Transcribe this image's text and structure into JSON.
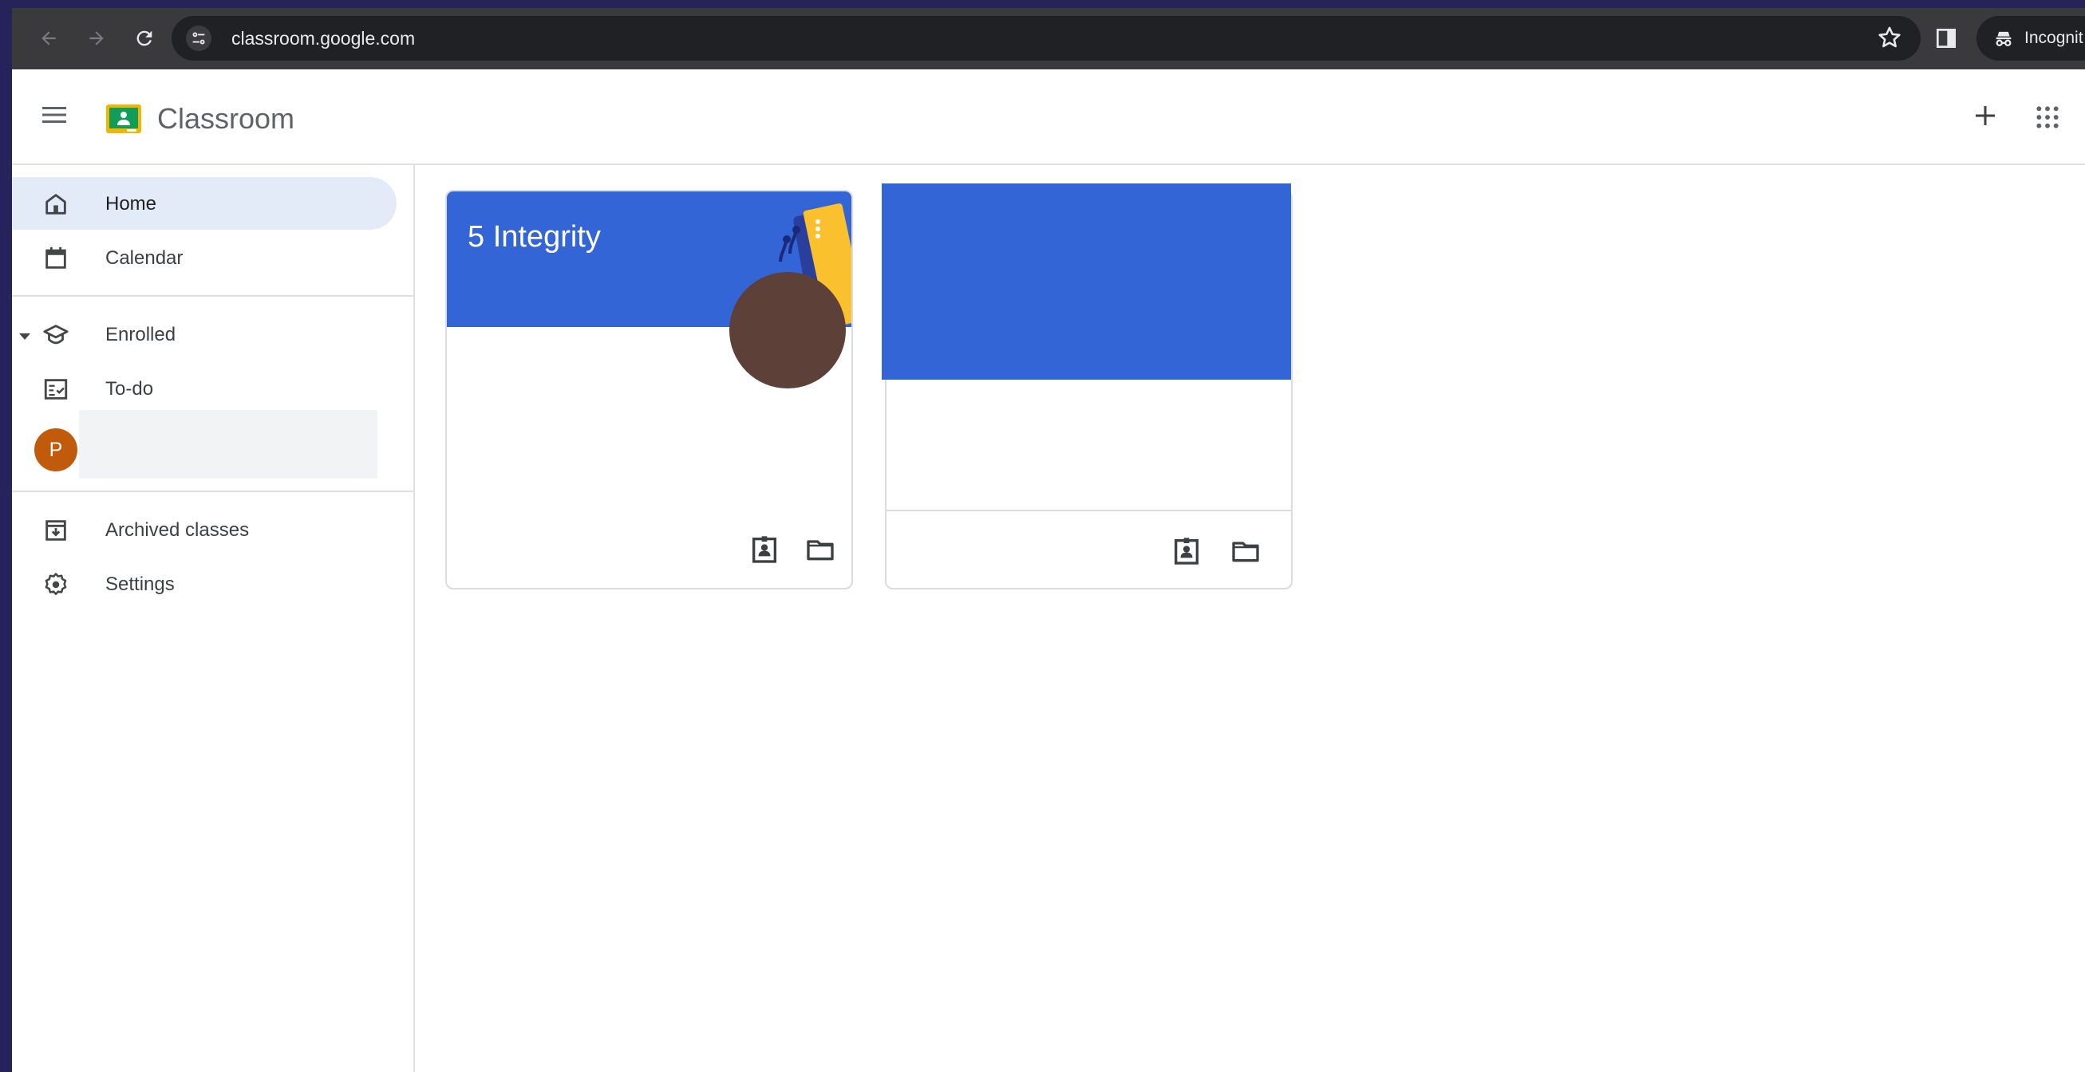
{
  "browser": {
    "url": "classroom.google.com",
    "incognito_label": "Incognit"
  },
  "app": {
    "title": "Classroom"
  },
  "sidebar": {
    "home": "Home",
    "calendar": "Calendar",
    "enrolled": "Enrolled",
    "todo": "To-do",
    "class_avatar_letter": "P",
    "archived": "Archived classes",
    "settings": "Settings"
  },
  "cards": [
    {
      "title": "5 Integrity",
      "banner_color": "#3465d6"
    },
    {
      "title": "",
      "banner_color": "#3465d6"
    }
  ],
  "colors": {
    "accent": "#3465d6",
    "active_nav_bg": "#e3ebf9",
    "avatar": "#c25a0c"
  }
}
